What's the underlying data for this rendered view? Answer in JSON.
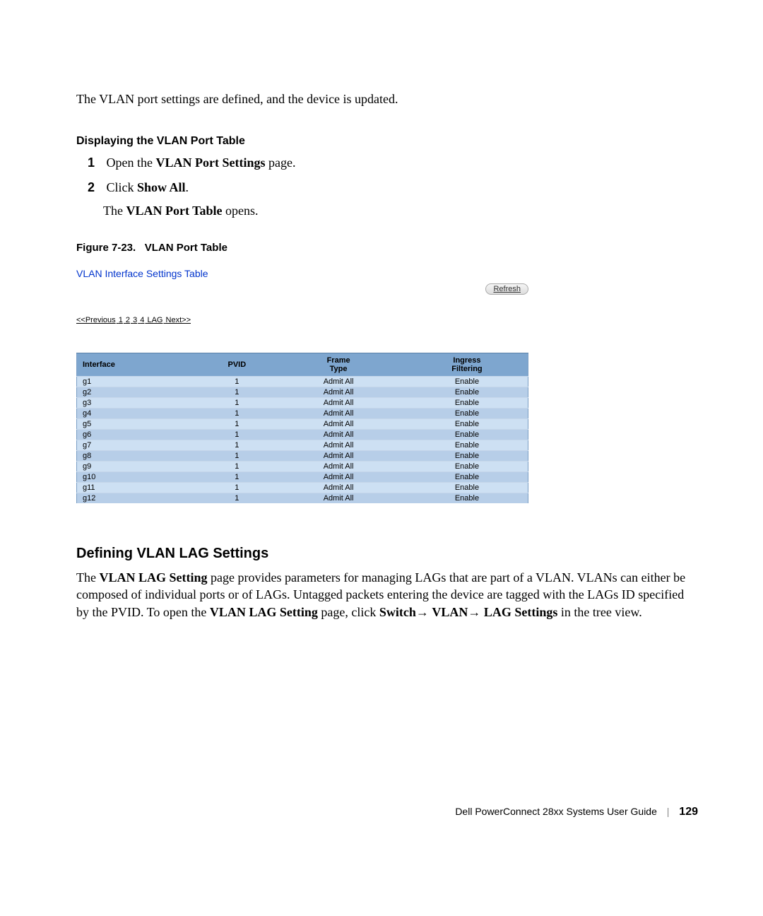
{
  "intro_text": "The VLAN port settings are defined, and the device is updated.",
  "section1": {
    "heading": "Displaying the VLAN Port Table",
    "steps": [
      {
        "num": "1",
        "pre": "Open the ",
        "bold": "VLAN Port Settings",
        "post": " page."
      },
      {
        "num": "2",
        "pre": "Click ",
        "bold": "Show All",
        "post": "."
      }
    ],
    "result_pre": "The ",
    "result_bold": "VLAN Port Table",
    "result_post": " opens."
  },
  "figure": {
    "caption_prefix": "Figure 7-23.",
    "caption_title": "VLAN Port Table"
  },
  "screenshot": {
    "title": "VLAN Interface Settings Table",
    "refresh": "Refresh",
    "pager": {
      "prev": "<<Previous",
      "p1": "1",
      "p2": "2",
      "p3": "3",
      "p4": "4",
      "lag": "LAG",
      "next": "Next>>"
    },
    "headers": {
      "interface": "Interface",
      "pvid": "PVID",
      "frame1": "Frame",
      "frame2": "Type",
      "ingress1": "Ingress",
      "ingress2": "Filtering"
    },
    "rows": [
      {
        "iface": "g1",
        "pvid": "1",
        "frame": "Admit All",
        "ingress": "Enable"
      },
      {
        "iface": "g2",
        "pvid": "1",
        "frame": "Admit All",
        "ingress": "Enable"
      },
      {
        "iface": "g3",
        "pvid": "1",
        "frame": "Admit All",
        "ingress": "Enable"
      },
      {
        "iface": "g4",
        "pvid": "1",
        "frame": "Admit All",
        "ingress": "Enable"
      },
      {
        "iface": "g5",
        "pvid": "1",
        "frame": "Admit All",
        "ingress": "Enable"
      },
      {
        "iface": "g6",
        "pvid": "1",
        "frame": "Admit All",
        "ingress": "Enable"
      },
      {
        "iface": "g7",
        "pvid": "1",
        "frame": "Admit All",
        "ingress": "Enable"
      },
      {
        "iface": "g8",
        "pvid": "1",
        "frame": "Admit All",
        "ingress": "Enable"
      },
      {
        "iface": "g9",
        "pvid": "1",
        "frame": "Admit All",
        "ingress": "Enable"
      },
      {
        "iface": "g10",
        "pvid": "1",
        "frame": "Admit All",
        "ingress": "Enable"
      },
      {
        "iface": "g11",
        "pvid": "1",
        "frame": "Admit All",
        "ingress": "Enable"
      },
      {
        "iface": "g12",
        "pvid": "1",
        "frame": "Admit All",
        "ingress": "Enable"
      }
    ]
  },
  "section2": {
    "heading": "Defining VLAN LAG Settings",
    "p1a": "The ",
    "p1b": "VLAN LAG Setting",
    "p1c": " page provides parameters for managing LAGs that are part of a VLAN. VLANs can either be composed of individual ports or of LAGs. Untagged packets entering the device are tagged with the LAGs ID specified by the PVID. To open the ",
    "p1d": "VLAN LAG Setting",
    "p1e": " page, click ",
    "p1f": "Switch",
    "arrow1": "→ ",
    "p1g": "VLAN",
    "arrow2": "→ ",
    "p1h": "LAG Settings",
    "p1i": " in the tree view."
  },
  "footer": {
    "title": "Dell PowerConnect 28xx Systems User Guide",
    "page": "129"
  },
  "chart_data": {
    "type": "table",
    "title": "VLAN Interface Settings Table",
    "columns": [
      "Interface",
      "PVID",
      "Frame Type",
      "Ingress Filtering"
    ],
    "rows": [
      [
        "g1",
        1,
        "Admit All",
        "Enable"
      ],
      [
        "g2",
        1,
        "Admit All",
        "Enable"
      ],
      [
        "g3",
        1,
        "Admit All",
        "Enable"
      ],
      [
        "g4",
        1,
        "Admit All",
        "Enable"
      ],
      [
        "g5",
        1,
        "Admit All",
        "Enable"
      ],
      [
        "g6",
        1,
        "Admit All",
        "Enable"
      ],
      [
        "g7",
        1,
        "Admit All",
        "Enable"
      ],
      [
        "g8",
        1,
        "Admit All",
        "Enable"
      ],
      [
        "g9",
        1,
        "Admit All",
        "Enable"
      ],
      [
        "g10",
        1,
        "Admit All",
        "Enable"
      ],
      [
        "g11",
        1,
        "Admit All",
        "Enable"
      ],
      [
        "g12",
        1,
        "Admit All",
        "Enable"
      ]
    ]
  }
}
